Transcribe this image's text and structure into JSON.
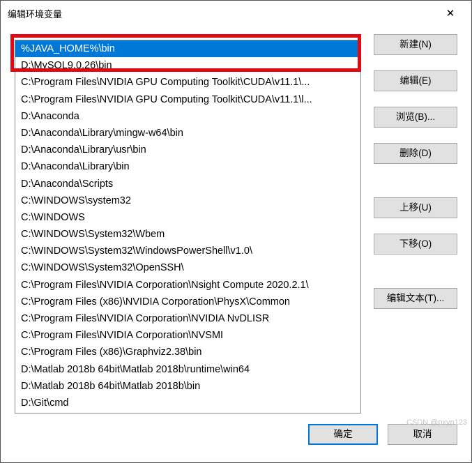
{
  "window": {
    "title": "编辑环境变量"
  },
  "list": {
    "items": [
      "%JAVA_HOME%\\bin",
      "D:\\MySQL9.0.26\\bin",
      "C:\\Program Files\\NVIDIA GPU Computing Toolkit\\CUDA\\v11.1\\...",
      "C:\\Program Files\\NVIDIA GPU Computing Toolkit\\CUDA\\v11.1\\l...",
      "D:\\Anaconda",
      "D:\\Anaconda\\Library\\mingw-w64\\bin",
      "D:\\Anaconda\\Library\\usr\\bin",
      "D:\\Anaconda\\Library\\bin",
      "D:\\Anaconda\\Scripts",
      "C:\\WINDOWS\\system32",
      "C:\\WINDOWS",
      "C:\\WINDOWS\\System32\\Wbem",
      "C:\\WINDOWS\\System32\\WindowsPowerShell\\v1.0\\",
      "C:\\WINDOWS\\System32\\OpenSSH\\",
      "C:\\Program Files\\NVIDIA Corporation\\Nsight Compute 2020.2.1\\",
      "C:\\Program Files (x86)\\NVIDIA Corporation\\PhysX\\Common",
      "C:\\Program Files\\NVIDIA Corporation\\NVIDIA NvDLISR",
      "C:\\Program Files\\NVIDIA Corporation\\NVSMI",
      "C:\\Program Files (x86)\\Graphviz2.38\\bin",
      "D:\\Matlab 2018b 64bit\\Matlab 2018b\\runtime\\win64",
      "D:\\Matlab 2018b 64bit\\Matlab 2018b\\bin",
      "D:\\Git\\cmd"
    ],
    "selected_index": 0
  },
  "buttons": {
    "new": "新建(N)",
    "edit": "编辑(E)",
    "browse": "浏览(B)...",
    "delete": "删除(D)",
    "moveup": "上移(U)",
    "movedown": "下移(O)",
    "edittext": "编辑文本(T)...",
    "ok": "确定",
    "cancel": "取消"
  },
  "watermark": {
    "line1": "CSDN @pxyp123"
  }
}
